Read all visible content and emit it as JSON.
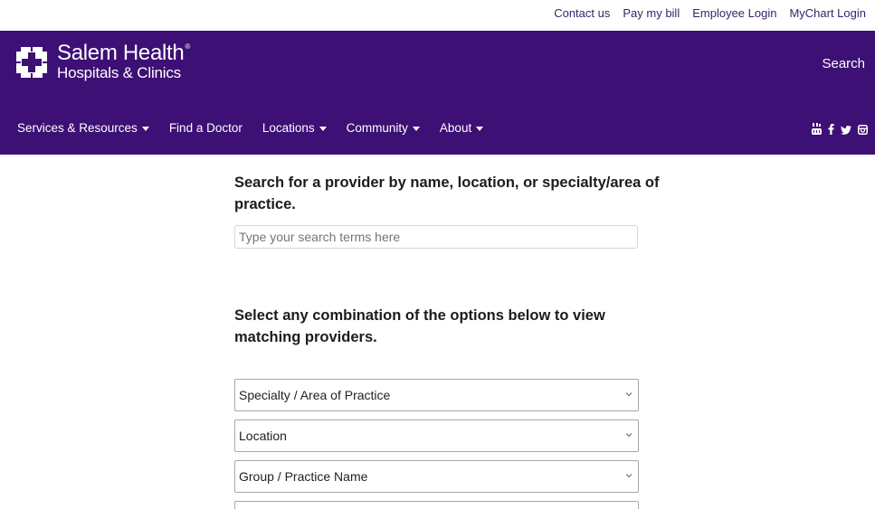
{
  "utility_links": [
    "Contact us",
    "Pay my bill",
    "Employee Login",
    "MyChart Login"
  ],
  "logo": {
    "title": "Salem Health",
    "registered": "®",
    "subtitle": "Hospitals & Clinics"
  },
  "header": {
    "search_label": "Search"
  },
  "nav": {
    "items": [
      {
        "label": "Services & Resources",
        "dropdown": true
      },
      {
        "label": "Find a Doctor",
        "dropdown": false
      },
      {
        "label": "Locations",
        "dropdown": true
      },
      {
        "label": "Community",
        "dropdown": true
      },
      {
        "label": "About",
        "dropdown": true
      }
    ]
  },
  "social_icons": [
    "youtube-icon",
    "facebook-icon",
    "twitter-icon",
    "instagram-icon"
  ],
  "search": {
    "heading": "Search for a provider by name, location, or specialty/area of practice.",
    "placeholder": "Type your search terms here",
    "value": ""
  },
  "filters": {
    "heading": "Select any combination of the options below to view matching providers.",
    "selects": [
      {
        "selected": "Specialty / Area of Practice"
      },
      {
        "selected": "Location"
      },
      {
        "selected": "Group / Practice Name"
      },
      {
        "selected": ""
      }
    ]
  },
  "colors": {
    "brand_purple": "#3d1075",
    "link_purple": "#3a1f6b",
    "text": "#1c1c1c"
  }
}
